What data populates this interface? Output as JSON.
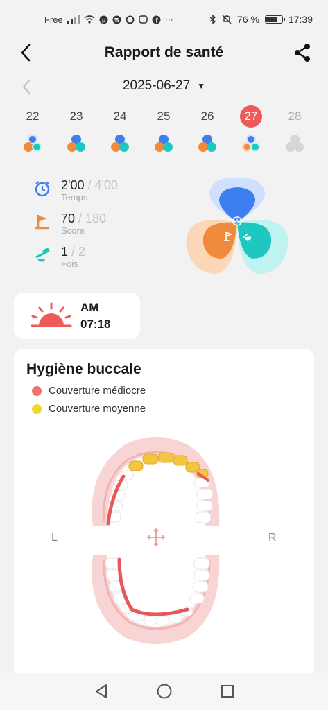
{
  "status_bar": {
    "carrier": "Free",
    "battery_text": "76 %",
    "battery_level": 0.76,
    "time": "17:39",
    "icons": [
      "signal-icon",
      "wifi-icon",
      "pinterest-icon",
      "spotify-icon",
      "sync-icon",
      "messenger-icon",
      "facebook-icon",
      "more-icon",
      "bluetooth-icon",
      "mute-icon",
      "battery-icon"
    ],
    "more": "···"
  },
  "header": {
    "title": "Rapport de santé",
    "back_icon": "back-arrow-icon",
    "share_icon": "share-icon"
  },
  "date_selector": {
    "date": "2025-06-27",
    "caret": "▼",
    "prev_icon": "chevron-left-icon"
  },
  "calendar": {
    "days": [
      {
        "num": "22",
        "state": "past"
      },
      {
        "num": "23",
        "state": "past"
      },
      {
        "num": "24",
        "state": "past"
      },
      {
        "num": "25",
        "state": "past"
      },
      {
        "num": "26",
        "state": "past"
      },
      {
        "num": "27",
        "state": "selected"
      },
      {
        "num": "28",
        "state": "future"
      }
    ]
  },
  "stats": {
    "time": {
      "value": "2'00",
      "total": " / 4'00",
      "label": "Temps"
    },
    "score": {
      "value": "70",
      "total": " / 180",
      "label": "Score"
    },
    "count": {
      "value": "1",
      "total": " / 2",
      "label": "Fois"
    }
  },
  "session": {
    "period": "AM",
    "time": "07:18",
    "icon": "sunrise-icon"
  },
  "hygiene": {
    "title": "Hygiène buccale",
    "legend": [
      {
        "label": "Couverture médiocre",
        "color": "#f07070"
      },
      {
        "label": "Couverture moyenne",
        "color": "#f0d830"
      }
    ],
    "left": "L",
    "right": "R"
  },
  "colors": {
    "accent": "#ee5a5a",
    "blue": "#3d7ff0",
    "orange": "#f08a3c",
    "teal": "#1ec8c0",
    "gum": "#f7c8c8"
  },
  "nav": {
    "back": "nav-back-icon",
    "home": "nav-home-icon",
    "recent": "nav-recent-icon"
  }
}
